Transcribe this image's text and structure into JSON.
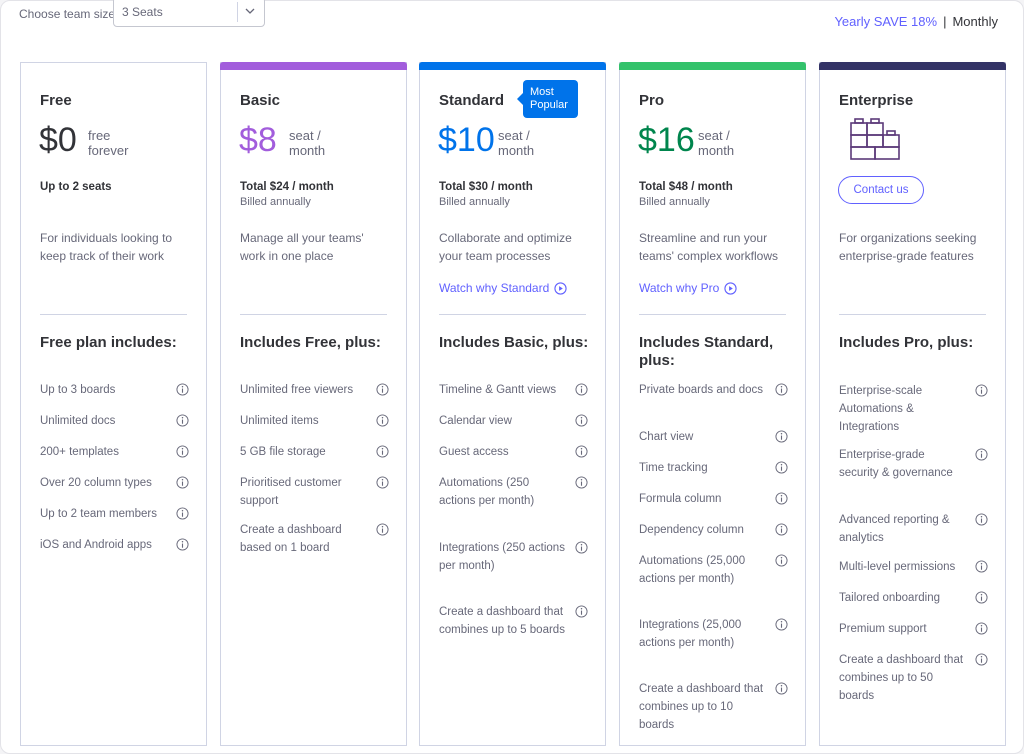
{
  "topbar": {
    "team_size_label": "Choose team size:",
    "team_size_value": "3 Seats",
    "billing_yearly": "Yearly SAVE 18%",
    "billing_separator": "|",
    "billing_monthly": "Monthly"
  },
  "colors": {
    "accent": "#6161ff",
    "basic": "#a25ddc",
    "standard": "#0073ea",
    "pro": "#00854d",
    "enterprise": "#333366"
  },
  "icons": {
    "info": "info-circle-icon",
    "play": "play-circle-icon",
    "chevron": "chevron-down-icon",
    "enterprise": "building-blocks-icon"
  },
  "plans": [
    {
      "name": "Free",
      "price": "$0",
      "price_sub": "free\nforever",
      "total": "Up to 2 seats",
      "billed": "",
      "description": "For individuals looking to keep track of their work",
      "watch": "",
      "includes": "Free plan includes:",
      "features": [
        "Up to 3 boards",
        "Unlimited docs",
        "200+ templates",
        "Over 20 column types",
        "Up to 2 team members",
        "iOS and Android apps"
      ]
    },
    {
      "name": "Basic",
      "price": "$8",
      "price_sub": "seat /\nmonth",
      "total": "Total $24 / month",
      "billed": "Billed annually",
      "description": "Manage all your teams' work in one place",
      "watch": "",
      "includes": "Includes Free, plus:",
      "features": [
        "Unlimited free viewers",
        "Unlimited items",
        "5 GB file storage",
        "Prioritised customer support",
        "Create a dashboard based on 1 board"
      ]
    },
    {
      "name": "Standard",
      "badge": "Most Popular",
      "price": "$10",
      "price_sub": "seat /\nmonth",
      "total": "Total $30 / month",
      "billed": "Billed annually",
      "description": "Collaborate and optimize your team processes",
      "watch": "Watch why Standard",
      "includes": "Includes Basic, plus:",
      "features": [
        "Timeline & Gantt views",
        "Calendar view",
        "Guest access",
        "Automations (250 actions per month)",
        "Integrations (250 actions per month)",
        "Create a dashboard that combines up to 5 boards"
      ]
    },
    {
      "name": "Pro",
      "price": "$16",
      "price_sub": "seat /\nmonth",
      "total": "Total $48 / month",
      "billed": "Billed annually",
      "description": "Streamline and run your teams' complex workflows",
      "watch": "Watch why Pro",
      "includes": "Includes Standard, plus:",
      "features": [
        "Private boards and docs",
        "Chart view",
        "Time tracking",
        "Formula column",
        "Dependency column",
        "Automations (25,000 actions per month)",
        "Integrations (25,000 actions per month)",
        "Create a dashboard that combines up to 10 boards"
      ]
    },
    {
      "name": "Enterprise",
      "contact": "Contact us",
      "description": "For organizations seeking enterprise-grade features",
      "includes": "Includes Pro, plus:",
      "features": [
        "Enterprise-scale Automations & Integrations",
        "Enterprise-grade security & governance",
        "Advanced reporting & analytics",
        "Multi-level permissions",
        "Tailored onboarding",
        "Premium support",
        "Create a dashboard that combines up to 50 boards"
      ]
    }
  ]
}
